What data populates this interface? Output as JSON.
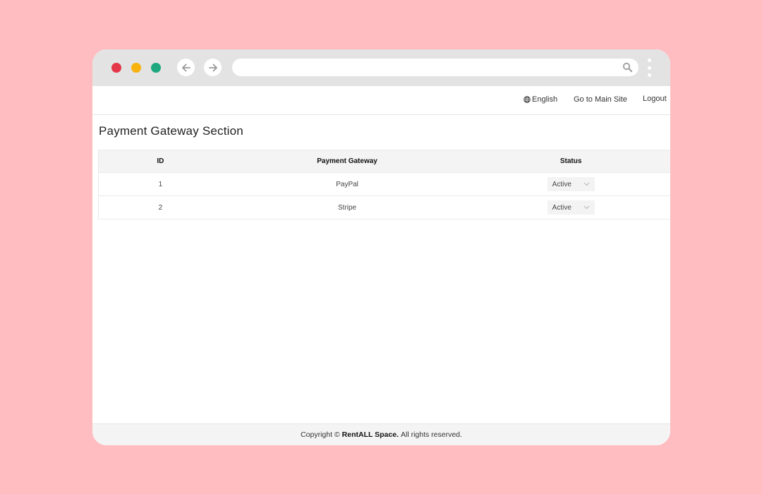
{
  "browser": {
    "traffic_lights": [
      "close",
      "minimize",
      "maximize"
    ],
    "colors": {
      "close": "#e5374a",
      "minimize": "#f8b20f",
      "maximize": "#1fa780"
    },
    "url": ""
  },
  "topnav": {
    "language": "English",
    "main_site": "Go to Main Site",
    "logout": "Logout"
  },
  "page": {
    "title": "Payment Gateway Section"
  },
  "table": {
    "headers": {
      "id": "ID",
      "gateway": "Payment Gateway",
      "status": "Status"
    },
    "rows": [
      {
        "id": "1",
        "gateway": "PayPal",
        "status": "Active"
      },
      {
        "id": "2",
        "gateway": "Stripe",
        "status": "Active"
      }
    ]
  },
  "footer": {
    "prefix": "Copyright ©",
    "brand": "RentALL Space.",
    "suffix": "All rights reserved."
  }
}
